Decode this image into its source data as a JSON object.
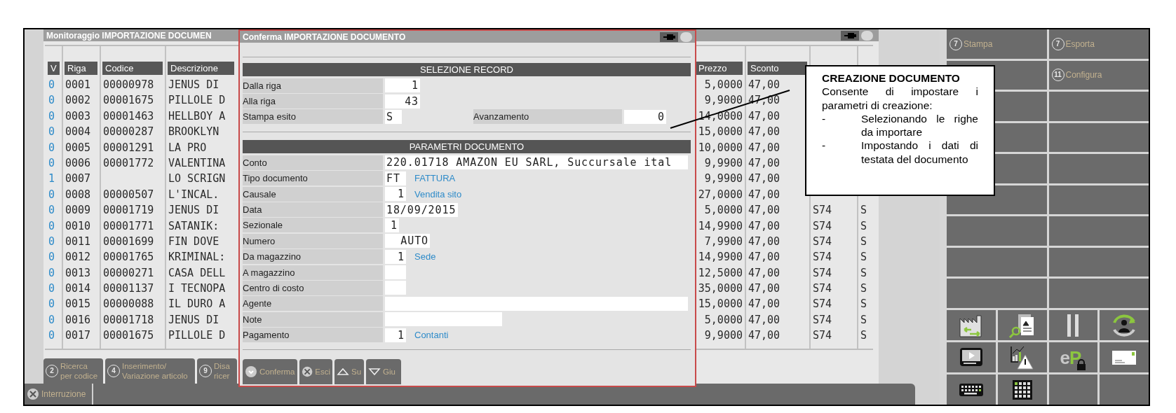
{
  "background_window": {
    "title": "Monitoraggio IMPORTAZIONE DOCUMEN",
    "columns_left": [
      "V",
      "Riga",
      "Codice",
      "Descrizione"
    ],
    "columns_right": [
      "Prezzo",
      "Sconto"
    ],
    "rows": [
      {
        "v": "0",
        "riga": "0001",
        "codice": "00000978",
        "descrizione": "JENUS DI",
        "prezzo": "5,0000",
        "sconto": "47,00"
      },
      {
        "v": "0",
        "riga": "0002",
        "codice": "00001675",
        "descrizione": "PILLOLE D",
        "prezzo": "9,9000",
        "sconto": "47,00"
      },
      {
        "v": "0",
        "riga": "0003",
        "codice": "00001463",
        "descrizione": "HELLBOY A",
        "prezzo": "14,0000",
        "sconto": "47,00"
      },
      {
        "v": "0",
        "riga": "0004",
        "codice": "00000287",
        "descrizione": "BROOKLYN",
        "prezzo": "15,0000",
        "sconto": "47,00"
      },
      {
        "v": "0",
        "riga": "0005",
        "codice": "00001291",
        "descrizione": "LA PRO",
        "prezzo": "10,0000",
        "sconto": "47,00"
      },
      {
        "v": "0",
        "riga": "0006",
        "codice": "00001772",
        "descrizione": "VALENTINA",
        "prezzo": "9,9900",
        "sconto": "47,00"
      },
      {
        "v": "1",
        "riga": "0007",
        "descrizione": "LO SCRIGN",
        "prezzo": "9,9900",
        "sconto": "47,00"
      },
      {
        "v": "0",
        "riga": "0008",
        "codice": "00000507",
        "descrizione": "L'INCAL.",
        "prezzo": "27,0000",
        "sconto": "47,00"
      },
      {
        "v": "0",
        "riga": "0009",
        "codice": "00001719",
        "descrizione": "JENUS DI",
        "prezzo": "5,0000",
        "sconto": "47,00",
        "column_7": "S74",
        "column_8": "S"
      },
      {
        "v": "0",
        "riga": "0010",
        "codice": "00001771",
        "descrizione": "SATANIK:",
        "prezzo": "14,9900",
        "sconto": "47,00",
        "column_7": "S74",
        "column_8": "S"
      },
      {
        "v": "0",
        "riga": "0011",
        "codice": "00001699",
        "descrizione": "FIN DOVE",
        "prezzo": "7,9900",
        "sconto": "47,00",
        "column_7": "S74",
        "column_8": "S"
      },
      {
        "v": "0",
        "riga": "0012",
        "codice": "00001765",
        "descrizione": "KRIMINAL:",
        "prezzo": "14,9900",
        "sconto": "47,00",
        "column_7": "S74",
        "column_8": "S"
      },
      {
        "v": "0",
        "riga": "0013",
        "codice": "00000271",
        "descrizione": "CASA DELL",
        "prezzo": "12,5000",
        "sconto": "47,00",
        "column_7": "S74",
        "column_8": "S"
      },
      {
        "v": "0",
        "riga": "0014",
        "codice": "00001137",
        "descrizione": "I TECNOPA",
        "prezzo": "35,0000",
        "sconto": "47,00",
        "column_7": "S74",
        "column_8": "S"
      },
      {
        "v": "0",
        "riga": "0015",
        "codice": "00000088",
        "descrizione": "IL DURO A",
        "prezzo": "15,0000",
        "sconto": "47,00",
        "column_7": "S74",
        "column_8": "S"
      },
      {
        "v": "0",
        "riga": "0016",
        "codice": "00001718",
        "descrizione": "JENUS DI",
        "prezzo": "5,0000",
        "sconto": "47,00",
        "column_7": "S74",
        "column_8": "S"
      },
      {
        "v": "0",
        "riga": "0017",
        "codice": "00001675",
        "descrizione": "PILLOLE D",
        "prezzo": "9,9000",
        "sconto": "47,00",
        "column_7": "S74",
        "column_8": "S"
      }
    ],
    "buttons": [
      {
        "key": "2",
        "lines": [
          "Ricerca",
          "per codice"
        ]
      },
      {
        "key": "4",
        "lines": [
          "Inserimento/",
          "Variazione articolo"
        ]
      },
      {
        "key": "9",
        "lines": [
          "Disa",
          "ricer"
        ]
      }
    ],
    "bottom_tab": {
      "label": "Interruzione"
    }
  },
  "dialog": {
    "title": "Conferma IMPORTAZIONE DOCUMENTO",
    "sections": [
      {
        "title": "SELEZIONE RECORD",
        "rows": [
          {
            "label": "Dalla riga",
            "value": "1"
          },
          {
            "label": "Alla riga",
            "value": "43"
          },
          {
            "label": "Stampa esito",
            "value": "S",
            "extra_label": "Avanzamento",
            "extra_value": "0"
          }
        ]
      },
      {
        "title": "PARAMETRI DOCUMENTO",
        "rows": [
          {
            "label": "Conto",
            "value": "220.01718 AMAZON EU SARL, Succursale ital"
          },
          {
            "label": "Tipo documento",
            "value": "FT",
            "description": "FATTURA"
          },
          {
            "label": "Causale",
            "value": "1",
            "description": "Vendita sito"
          },
          {
            "label": "Data",
            "value": "18/09/2015"
          },
          {
            "label": "Sezionale",
            "value": "1"
          },
          {
            "label": "Numero",
            "value": "AUTO"
          },
          {
            "label": "Da magazzino",
            "value": "1",
            "description": "Sede"
          },
          {
            "label": "A magazzino"
          },
          {
            "label": "Centro di costo"
          },
          {
            "label": "Agente"
          },
          {
            "label": "Note"
          },
          {
            "label": "Pagamento",
            "value": "1",
            "description": "Contanti"
          }
        ]
      }
    ],
    "buttons": [
      {
        "kind": "confirm",
        "label": "Conferma"
      },
      {
        "kind": "exit",
        "label": "Esci"
      },
      {
        "kind": "up",
        "label": "Su"
      },
      {
        "kind": "down",
        "label": "Giu"
      }
    ]
  },
  "callout": {
    "title": "CREAZIONE DOCUMENTO",
    "text": "Consente di impostare i parametri di creazione:",
    "items": [
      {
        "bullet": "-",
        "text": "Selezionando le righe da importare"
      },
      {
        "bullet": "-",
        "text": "Impostando i dati di testata del documento"
      }
    ]
  },
  "function_keys": [
    {
      "key": "7",
      "label": "Stampa"
    },
    {
      "key": "7",
      "label": "Esporta"
    },
    {
      "key": "11",
      "label": "Configura"
    }
  ],
  "toolbar_icons": [
    {
      "kind": "factory"
    },
    {
      "kind": "document-search"
    },
    {
      "kind": "pause"
    },
    {
      "kind": "user-sync"
    },
    {
      "kind": "play-screen"
    },
    {
      "kind": "chart-warning"
    },
    {
      "kind": "ep-lock",
      "label": "eP"
    },
    {
      "kind": "card"
    },
    {
      "kind": "keyboard"
    },
    {
      "kind": "keypad"
    }
  ]
}
